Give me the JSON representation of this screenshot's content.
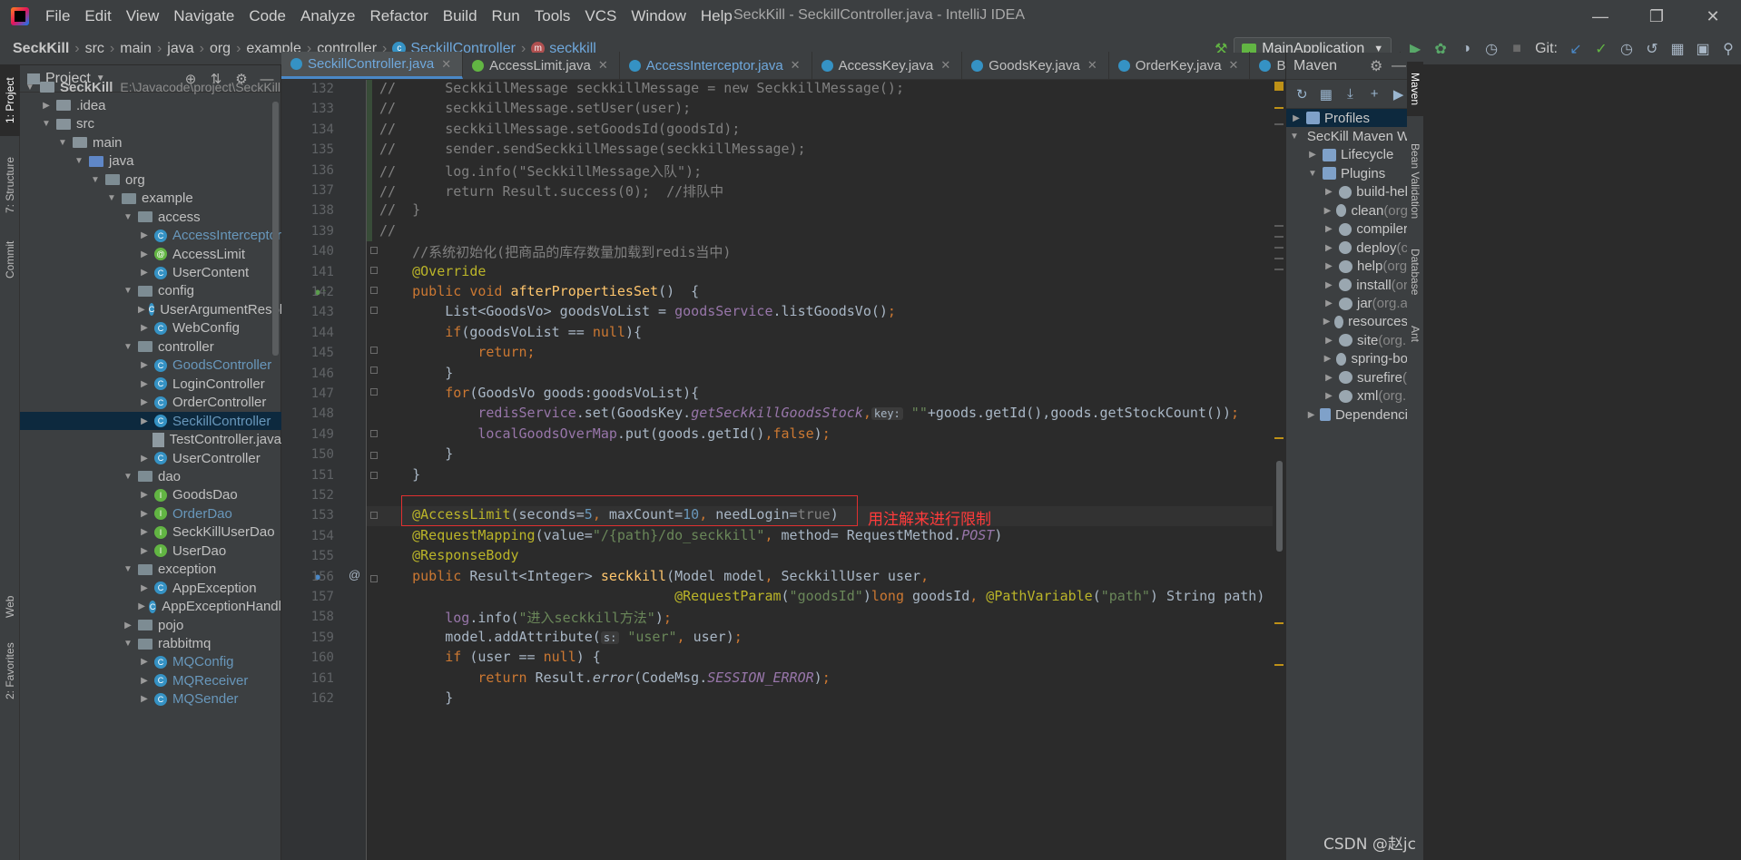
{
  "window": {
    "title": "SeckKill - SeckillController.java - IntelliJ IDEA",
    "menus": [
      "File",
      "Edit",
      "View",
      "Navigate",
      "Code",
      "Analyze",
      "Refactor",
      "Build",
      "Run",
      "Tools",
      "VCS",
      "Window",
      "Help"
    ]
  },
  "breadcrumb": [
    "SeckKill",
    "src",
    "main",
    "java",
    "org",
    "example",
    "controller",
    "SeckillController",
    "seckkill"
  ],
  "toolbar": {
    "run_config": "MainApplication",
    "git_label": "Git:"
  },
  "left_tabs": [
    "1: Project",
    "7: Structure",
    "Commit",
    "Web",
    "2: Favorites"
  ],
  "project": {
    "title": "Project",
    "tree": [
      {
        "label": "SeckKill",
        "path": "E:\\Javacode\\project\\SeckKill",
        "depth": 0,
        "type": "module",
        "open": true
      },
      {
        "label": ".idea",
        "depth": 1,
        "type": "folder",
        "open": false
      },
      {
        "label": "src",
        "depth": 1,
        "type": "folder",
        "open": true
      },
      {
        "label": "main",
        "depth": 2,
        "type": "folder",
        "open": true
      },
      {
        "label": "java",
        "depth": 3,
        "type": "src",
        "open": true
      },
      {
        "label": "org",
        "depth": 4,
        "type": "package",
        "open": true
      },
      {
        "label": "example",
        "depth": 5,
        "type": "package",
        "open": true
      },
      {
        "label": "access",
        "depth": 6,
        "type": "package",
        "open": true
      },
      {
        "label": "AccessInterceptor",
        "depth": 7,
        "type": "class",
        "vcs": true
      },
      {
        "label": "AccessLimit",
        "depth": 7,
        "type": "annotation"
      },
      {
        "label": "UserContent",
        "depth": 7,
        "type": "class"
      },
      {
        "label": "config",
        "depth": 6,
        "type": "package",
        "open": true
      },
      {
        "label": "UserArgumentResol",
        "depth": 7,
        "type": "class"
      },
      {
        "label": "WebConfig",
        "depth": 7,
        "type": "class"
      },
      {
        "label": "controller",
        "depth": 6,
        "type": "package",
        "open": true
      },
      {
        "label": "GoodsController",
        "depth": 7,
        "type": "class",
        "vcs": true
      },
      {
        "label": "LoginController",
        "depth": 7,
        "type": "class"
      },
      {
        "label": "OrderController",
        "depth": 7,
        "type": "class"
      },
      {
        "label": "SeckillController",
        "depth": 7,
        "type": "class",
        "vcs": true,
        "selected": true
      },
      {
        "label": "TestController.java",
        "depth": 7,
        "type": "file"
      },
      {
        "label": "UserController",
        "depth": 7,
        "type": "class"
      },
      {
        "label": "dao",
        "depth": 6,
        "type": "package",
        "open": true
      },
      {
        "label": "GoodsDao",
        "depth": 7,
        "type": "interface"
      },
      {
        "label": "OrderDao",
        "depth": 7,
        "type": "interface",
        "vcs": true
      },
      {
        "label": "SeckKillUserDao",
        "depth": 7,
        "type": "interface"
      },
      {
        "label": "UserDao",
        "depth": 7,
        "type": "interface"
      },
      {
        "label": "exception",
        "depth": 6,
        "type": "package",
        "open": true
      },
      {
        "label": "AppException",
        "depth": 7,
        "type": "class"
      },
      {
        "label": "AppExceptionHandl",
        "depth": 7,
        "type": "class"
      },
      {
        "label": "pojo",
        "depth": 6,
        "type": "package",
        "open": false
      },
      {
        "label": "rabbitmq",
        "depth": 6,
        "type": "package",
        "open": true
      },
      {
        "label": "MQConfig",
        "depth": 7,
        "type": "class",
        "vcs": true
      },
      {
        "label": "MQReceiver",
        "depth": 7,
        "type": "class",
        "vcs": true
      },
      {
        "label": "MQSender",
        "depth": 7,
        "type": "class",
        "vcs": true
      }
    ]
  },
  "editor_tabs": [
    {
      "label": "SeckillController.java",
      "icon": "c",
      "active": true,
      "closable": true
    },
    {
      "label": "AccessLimit.java",
      "icon": "a",
      "closable": true
    },
    {
      "label": "AccessInterceptor.java",
      "icon": "c",
      "blue": true,
      "closable": true
    },
    {
      "label": "AccessKey.java",
      "icon": "c",
      "closable": true
    },
    {
      "label": "GoodsKey.java",
      "icon": "c",
      "closable": true
    },
    {
      "label": "OrderKey.java",
      "icon": "c",
      "closable": true
    },
    {
      "label": "BasePrefix.java",
      "icon": "c",
      "closable": true
    }
  ],
  "code": {
    "lines": [
      {
        "n": "132",
        "segs": [
          [
            "c",
            "//      SeckkillMessage seckkillMessage = new SeckkillMessage();"
          ]
        ]
      },
      {
        "n": "133",
        "segs": [
          [
            "c",
            "//      seckkillMessage.setUser(user);"
          ]
        ]
      },
      {
        "n": "134",
        "segs": [
          [
            "c",
            "//      seckkillMessage.setGoodsId(goodsId);"
          ]
        ]
      },
      {
        "n": "135",
        "segs": [
          [
            "c",
            "//      sender.sendSeckkillMessage(seckkillMessage);"
          ]
        ]
      },
      {
        "n": "136",
        "segs": [
          [
            "c",
            "//      log.info(\"SeckkillMessage入队\");"
          ]
        ]
      },
      {
        "n": "137",
        "segs": [
          [
            "c",
            "//      return Result.success(0);  //排队中"
          ]
        ]
      },
      {
        "n": "138",
        "segs": [
          [
            "c",
            "//  }"
          ]
        ]
      },
      {
        "n": "139",
        "segs": [
          [
            "c",
            "//"
          ]
        ]
      },
      {
        "n": "140",
        "segs": [
          [
            "c",
            "    //系统初始化(把商品的库存数量加载到redis当中)"
          ]
        ]
      },
      {
        "n": "141",
        "segs": [
          [
            "x",
            "    "
          ],
          [
            "a",
            "@Override"
          ]
        ]
      },
      {
        "n": "142",
        "segs": [
          [
            "x",
            "    "
          ],
          [
            "k",
            "public void "
          ],
          [
            "f",
            "afterPropertiesSet"
          ],
          [
            "x",
            "()  {"
          ]
        ]
      },
      {
        "n": "143",
        "segs": [
          [
            "x",
            "        List<GoodsVo> goodsVoList = "
          ],
          [
            "m",
            "goodsService"
          ],
          [
            "x",
            ".listGoodsVo()"
          ],
          [
            "k",
            ";"
          ]
        ]
      },
      {
        "n": "144",
        "segs": [
          [
            "x",
            "        "
          ],
          [
            "k",
            "if"
          ],
          [
            "x",
            "(goodsVoList == "
          ],
          [
            "k",
            "null"
          ],
          [
            "x",
            "){"
          ]
        ]
      },
      {
        "n": "145",
        "segs": [
          [
            "x",
            "            "
          ],
          [
            "k",
            "return;"
          ]
        ]
      },
      {
        "n": "146",
        "segs": [
          [
            "x",
            "        }"
          ]
        ]
      },
      {
        "n": "147",
        "segs": [
          [
            "x",
            "        "
          ],
          [
            "k",
            "for"
          ],
          [
            "x",
            "(GoodsVo goods:goodsVoList){"
          ]
        ]
      },
      {
        "n": "148",
        "segs": [
          [
            "x",
            "            "
          ],
          [
            "m",
            "redisService"
          ],
          [
            "x",
            ".set(GoodsKey."
          ],
          [
            "i",
            "getSeckkillGoodsStock"
          ],
          [
            "k",
            ","
          ],
          [
            "h",
            "key:"
          ],
          [
            "s",
            " \"\""
          ],
          [
            "x",
            "+goods.getId(),goods.getStockCount())"
          ],
          [
            "k",
            ";"
          ]
        ]
      },
      {
        "n": "149",
        "segs": [
          [
            "x",
            "            "
          ],
          [
            "m",
            "localGoodsOverMap"
          ],
          [
            "x",
            ".put(goods.getId()"
          ],
          [
            "k",
            ","
          ],
          [
            "k",
            "false"
          ],
          [
            "x",
            ")"
          ],
          [
            "k",
            ";"
          ]
        ]
      },
      {
        "n": "150",
        "segs": [
          [
            "x",
            "        }"
          ]
        ]
      },
      {
        "n": "151",
        "segs": [
          [
            "x",
            "    }"
          ]
        ]
      },
      {
        "n": "152",
        "segs": [
          [
            "x",
            ""
          ]
        ]
      },
      {
        "n": "153",
        "segs": [
          [
            "x",
            "    "
          ],
          [
            "a",
            "@AccessLimit"
          ],
          [
            "x",
            "(seconds="
          ],
          [
            "n",
            "5"
          ],
          [
            "k",
            ", "
          ],
          [
            "x",
            "maxCount="
          ],
          [
            "n",
            "10"
          ],
          [
            "k",
            ", "
          ],
          [
            "x",
            "needLogin="
          ],
          [
            "gray",
            "true"
          ],
          [
            "x",
            ")"
          ]
        ]
      },
      {
        "n": "154",
        "segs": [
          [
            "x",
            "    "
          ],
          [
            "a",
            "@RequestMapping"
          ],
          [
            "x",
            "(value="
          ],
          [
            "s",
            "\"/{path}/do_seckkill\""
          ],
          [
            "k",
            ", "
          ],
          [
            "x",
            "method= RequestMethod."
          ],
          [
            "i",
            "POST"
          ],
          [
            "x",
            ")"
          ]
        ]
      },
      {
        "n": "155",
        "segs": [
          [
            "x",
            "    "
          ],
          [
            "a",
            "@ResponseBody"
          ]
        ]
      },
      {
        "n": "156",
        "segs": [
          [
            "x",
            "    "
          ],
          [
            "k",
            "public "
          ],
          [
            "x",
            "Result<Integer> "
          ],
          [
            "f",
            "seckkill"
          ],
          [
            "x",
            "(Model model"
          ],
          [
            "k",
            ", "
          ],
          [
            "x",
            "SeckkillUser user"
          ],
          [
            "k",
            ","
          ]
        ]
      },
      {
        "n": "157",
        "segs": [
          [
            "x",
            "                                    "
          ],
          [
            "a",
            "@RequestParam"
          ],
          [
            "x",
            "("
          ],
          [
            "s",
            "\"goodsId\""
          ],
          [
            "x",
            ")"
          ],
          [
            "k",
            "long "
          ],
          [
            "x",
            "goodsId"
          ],
          [
            "k",
            ", "
          ],
          [
            "a",
            "@PathVariable"
          ],
          [
            "x",
            "("
          ],
          [
            "s",
            "\"path\""
          ],
          [
            "x",
            ") String path) {"
          ]
        ]
      },
      {
        "n": "158",
        "segs": [
          [
            "x",
            "        "
          ],
          [
            "m",
            "log"
          ],
          [
            "x",
            ".info("
          ],
          [
            "s",
            "\"进入seckkill方法\""
          ],
          [
            "x",
            ")"
          ],
          [
            "k",
            ";"
          ]
        ]
      },
      {
        "n": "159",
        "segs": [
          [
            "x",
            "        model.addAttribute("
          ],
          [
            "h",
            "s:"
          ],
          [
            "s",
            " \"user\""
          ],
          [
            "k",
            ", "
          ],
          [
            "x",
            "user)"
          ],
          [
            "k",
            ";"
          ]
        ]
      },
      {
        "n": "160",
        "segs": [
          [
            "x",
            "        "
          ],
          [
            "k",
            "if "
          ],
          [
            "x",
            "(user == "
          ],
          [
            "k",
            "null"
          ],
          [
            "x",
            ") {"
          ]
        ]
      },
      {
        "n": "161",
        "segs": [
          [
            "x",
            "            "
          ],
          [
            "k",
            "return "
          ],
          [
            "x",
            "Result."
          ],
          [
            "fi",
            "error"
          ],
          [
            "x",
            "(CodeMsg."
          ],
          [
            "i",
            "SESSION_ERROR"
          ],
          [
            "x",
            ")"
          ],
          [
            "k",
            ";"
          ]
        ]
      },
      {
        "n": "162",
        "segs": [
          [
            "x",
            "        }"
          ]
        ]
      }
    ]
  },
  "annotation": {
    "text": "用注解来进行限制",
    "color": "#ff3b3b"
  },
  "maven": {
    "title": "Maven",
    "rows": [
      {
        "label": "Profiles",
        "depth": 0,
        "open": false,
        "selected": true
      },
      {
        "label": "SecKill Maven W",
        "depth": 0,
        "open": true
      },
      {
        "label": "Lifecycle",
        "depth": 1,
        "open": false
      },
      {
        "label": "Plugins",
        "depth": 1,
        "open": true
      },
      {
        "label": "build-hel",
        "depth": 2,
        "open": false
      },
      {
        "label": "clean",
        "gray": " (org",
        "depth": 2,
        "open": false
      },
      {
        "label": "compiler",
        "depth": 2,
        "open": false
      },
      {
        "label": "deploy",
        "gray": " (c",
        "depth": 2,
        "open": false
      },
      {
        "label": "help",
        "gray": " (org",
        "depth": 2,
        "open": false
      },
      {
        "label": "install",
        "gray": " (or",
        "depth": 2,
        "open": false
      },
      {
        "label": "jar",
        "gray": " (org.a",
        "depth": 2,
        "open": false
      },
      {
        "label": "resources",
        "depth": 2,
        "open": false
      },
      {
        "label": "site",
        "gray": " (org.",
        "depth": 2,
        "open": false
      },
      {
        "label": "spring-bo",
        "depth": 2,
        "open": false
      },
      {
        "label": "surefire",
        "gray": " (",
        "depth": 2,
        "open": false
      },
      {
        "label": "xml",
        "gray": " (org.",
        "depth": 2,
        "open": false
      },
      {
        "label": "Dependenci",
        "depth": 1,
        "open": false
      }
    ]
  },
  "right_tabs": [
    "Maven",
    "Bean Validation",
    "Database",
    "Ant"
  ],
  "watermark": "CSDN @赵jc",
  "colors": {
    "accent": "#4a88c7",
    "annotation_box": "#e03030"
  }
}
